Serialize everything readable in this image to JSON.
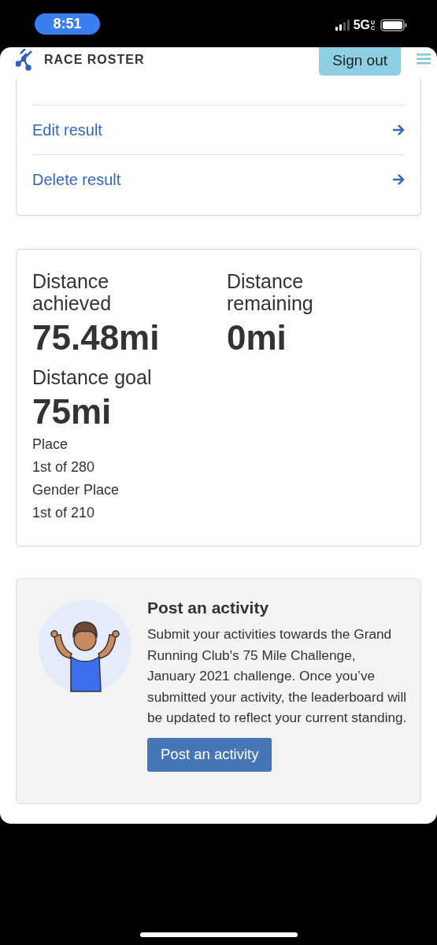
{
  "status_bar": {
    "time": "8:51",
    "network": "5G",
    "network_suffix": "UC"
  },
  "header": {
    "logo": "RACE ROSTER",
    "sign_out": "Sign out"
  },
  "result_links": [
    {
      "label": "Edit result"
    },
    {
      "label": "Delete result"
    }
  ],
  "stats": {
    "items": [
      {
        "label": "Distance achieved",
        "value": "75.48mi"
      },
      {
        "label": "Distance remaining",
        "value": "0mi"
      },
      {
        "label": "Distance goal",
        "value": "75mi"
      }
    ],
    "details": [
      "Place",
      "1st of 280",
      "Gender Place",
      "1st of 210"
    ]
  },
  "activity": {
    "title": "Post an activity",
    "body": "Submit your activities towards the Grand Running Club's 75 Mile Challenge, January 2021 challenge. Once you’ve submitted your activity, the leaderboard will be updated to reflect your current standing.",
    "button": "Post an activity"
  }
}
